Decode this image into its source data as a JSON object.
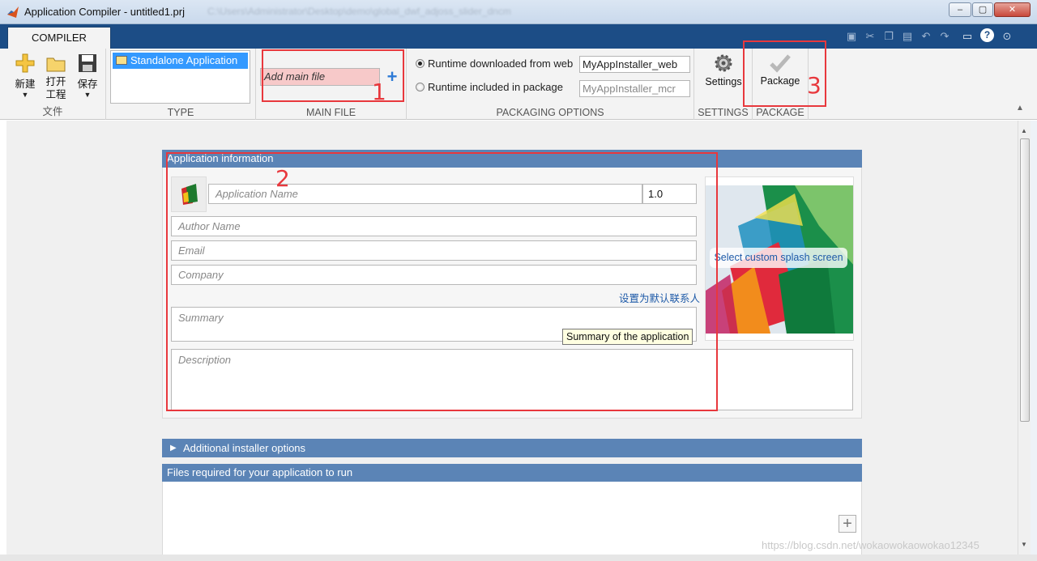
{
  "window": {
    "title": "Application Compiler - untitled1.prj",
    "controls": [
      "minimize",
      "maximize",
      "close"
    ]
  },
  "toolstrip": {
    "tab_label": "COMPILER"
  },
  "ribbon": {
    "file_group": {
      "label": "文件",
      "new_label": "新建",
      "open_label": "打开\n工程",
      "open_line1": "打开",
      "open_line2": "工程",
      "save_label": "保存"
    },
    "type_group": {
      "label": "TYPE",
      "selected": "Standalone Application"
    },
    "main_file_group": {
      "label": "MAIN FILE",
      "placeholder": "Add main file"
    },
    "packaging_group": {
      "label": "PACKAGING OPTIONS",
      "options": [
        {
          "label": "Runtime downloaded from web",
          "value": "MyAppInstaller_web",
          "selected": true
        },
        {
          "label": "Runtime included in package",
          "value": "MyAppInstaller_mcr",
          "selected": false
        }
      ]
    },
    "settings_group": {
      "label": "SETTINGS",
      "button": "Settings"
    },
    "package_group": {
      "label": "PACKAGE",
      "button": "Package"
    }
  },
  "annotations": {
    "box1": "1",
    "box2": "2",
    "box3": "3"
  },
  "app_info": {
    "header": "Application information",
    "app_name_placeholder": "Application Name",
    "version": "1.0",
    "author_placeholder": "Author Name",
    "email_placeholder": "Email",
    "company_placeholder": "Company",
    "default_contact_link": "设置为默认联系人",
    "summary_placeholder": "Summary",
    "summary_tooltip": "Summary of the application",
    "description_placeholder": "Description",
    "splash_button": "Select custom splash screen"
  },
  "additional_options": {
    "header": "Additional installer options"
  },
  "files_required": {
    "header": "Files required for your application to run"
  },
  "watermark": "https://blog.csdn.net/wokaowokaowokao12345",
  "colors": {
    "section_header": "#5b84b6",
    "tab_strip": "#1c4d86",
    "selection": "#3399ff",
    "annotation_red": "#e8383d",
    "main_file_bg": "#f7c9c9"
  }
}
